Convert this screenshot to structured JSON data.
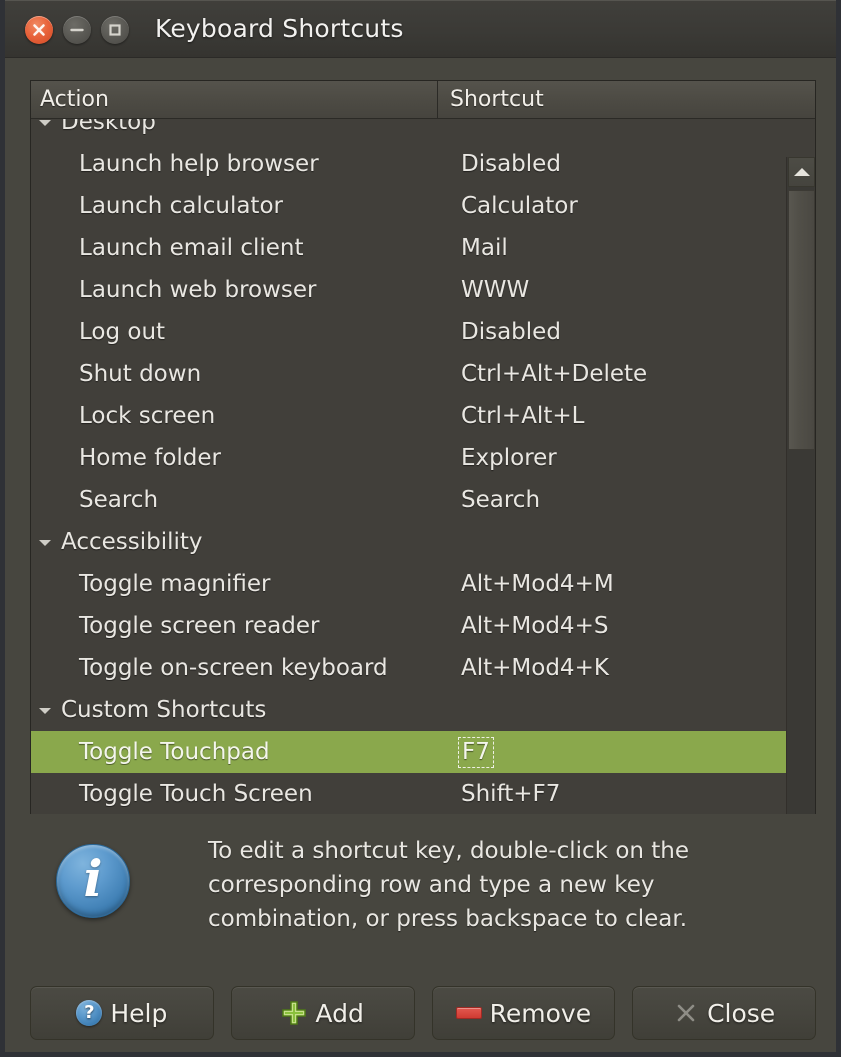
{
  "window": {
    "title": "Keyboard Shortcuts",
    "controls": {
      "close": "close-button",
      "minimize": "minimize-button",
      "maximize": "maximize-button"
    }
  },
  "table": {
    "columns": [
      "Action",
      "Shortcut"
    ],
    "rows": [
      {
        "type": "group",
        "action": "Desktop",
        "shortcut": ""
      },
      {
        "type": "item",
        "action": "Launch help browser",
        "shortcut": "Disabled"
      },
      {
        "type": "item",
        "action": "Launch calculator",
        "shortcut": "Calculator"
      },
      {
        "type": "item",
        "action": "Launch email client",
        "shortcut": "Mail"
      },
      {
        "type": "item",
        "action": "Launch web browser",
        "shortcut": "WWW"
      },
      {
        "type": "item",
        "action": "Log out",
        "shortcut": "Disabled"
      },
      {
        "type": "item",
        "action": "Shut down",
        "shortcut": "Ctrl+Alt+Delete"
      },
      {
        "type": "item",
        "action": "Lock screen",
        "shortcut": "Ctrl+Alt+L"
      },
      {
        "type": "item",
        "action": "Home folder",
        "shortcut": "Explorer"
      },
      {
        "type": "item",
        "action": "Search",
        "shortcut": "Search"
      },
      {
        "type": "group",
        "action": "Accessibility",
        "shortcut": ""
      },
      {
        "type": "item",
        "action": "Toggle magnifier",
        "shortcut": "Alt+Mod4+M"
      },
      {
        "type": "item",
        "action": "Toggle screen reader",
        "shortcut": "Alt+Mod4+S"
      },
      {
        "type": "item",
        "action": "Toggle on-screen keyboard",
        "shortcut": "Alt+Mod4+K"
      },
      {
        "type": "group",
        "action": "Custom Shortcuts",
        "shortcut": ""
      },
      {
        "type": "item",
        "action": "Toggle Touchpad",
        "shortcut": "F7",
        "selected": true,
        "focused": true
      },
      {
        "type": "item",
        "action": "Toggle Touch Screen",
        "shortcut": "Shift+F7"
      }
    ],
    "selection_color": "#8aa84c"
  },
  "info": {
    "icon": "info-icon",
    "glyph": "i",
    "text": "To edit a shortcut key, double-click on the corresponding row and type a new key combination, or press backspace to clear."
  },
  "buttons": [
    {
      "label": "Help",
      "icon": "question-mark-icon",
      "name": "help-button"
    },
    {
      "label": "Add",
      "icon": "plus-icon",
      "name": "add-button"
    },
    {
      "label": "Remove",
      "icon": "minus-icon",
      "name": "remove-button"
    },
    {
      "label": "Close",
      "icon": "close-x-icon",
      "name": "close-button"
    }
  ],
  "scrollbar": {
    "up_arrow": "chevron-up-icon",
    "down_arrow": "chevron-down-icon"
  },
  "theme": {
    "window_bg": "#47463f",
    "titlebar_bg": "#3b3a36",
    "text": "#e9e7e2",
    "accent_close": "#e8623a",
    "accent_selection": "#8aa84c",
    "accent_info": "#3f7fb4",
    "accent_remove": "#cf3a32",
    "accent_add": "#8ac03c"
  }
}
